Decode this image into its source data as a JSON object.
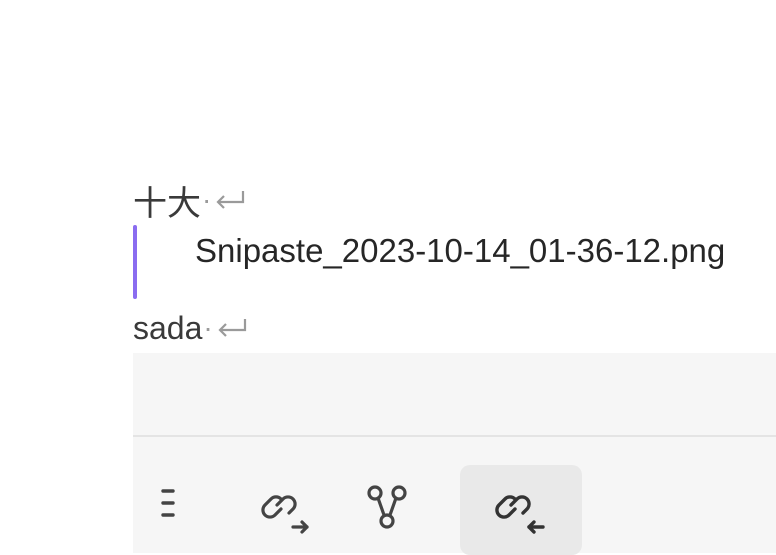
{
  "editor": {
    "lines": [
      {
        "text": "十大",
        "trailing_marks": [
          "·",
          "↵"
        ]
      },
      {
        "text": "sada",
        "trailing_marks": [
          "·",
          "↵"
        ]
      }
    ],
    "embed": {
      "filename": "Snipaste_2023-10-14_01-36-12.png",
      "accent_color": "#8a6cf0"
    }
  },
  "sidepanel": {
    "tabs": [
      {
        "icon": "list-icon",
        "active": false
      },
      {
        "icon": "outgoing-links-icon",
        "active": false
      },
      {
        "icon": "local-graph-icon",
        "active": false
      },
      {
        "icon": "backlinks-icon",
        "active": true
      }
    ]
  }
}
